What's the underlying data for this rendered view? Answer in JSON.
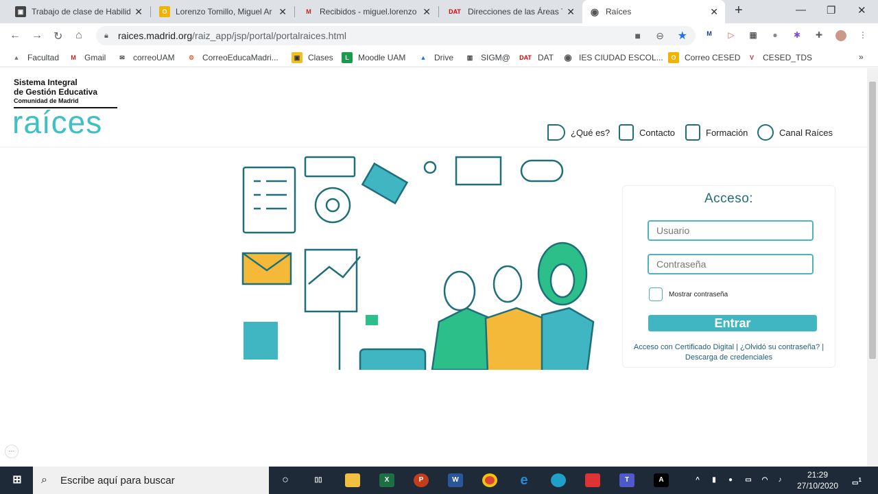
{
  "browser": {
    "tabs": [
      {
        "title": "Trabajo de clase de Habilid",
        "icon": "classroom-icon",
        "color": "#444"
      },
      {
        "title": "Lorenzo Tomillo, Miguel Ar",
        "icon": "outlook-icon",
        "color": "#f0b400"
      },
      {
        "title": "Recibidos - miguel.lorenzo",
        "icon": "gmail-icon",
        "color": "#c5221f"
      },
      {
        "title": "Direcciones de las Áreas Te",
        "icon": "dat-icon",
        "color": "#d00"
      },
      {
        "title": "Raíces",
        "icon": "globe-icon",
        "color": "#555"
      }
    ],
    "new_tab": "+",
    "url_host": "raices.madrid.org",
    "url_path": "/raiz_app/jsp/portal/portalraices.html",
    "bookmarks": [
      {
        "label": "Facultad",
        "color": "#777"
      },
      {
        "label": "Gmail",
        "color": "#c5221f"
      },
      {
        "label": "correoUAM",
        "color": "#444"
      },
      {
        "label": "CorreoEducaMadri...",
        "color": "#e06030"
      },
      {
        "label": "Clases",
        "color": "#f0c020"
      },
      {
        "label": "Moodle UAM",
        "color": "#1a9a4a"
      },
      {
        "label": "Drive",
        "color": "#1a73e8"
      },
      {
        "label": "SIGM@",
        "color": "#333"
      },
      {
        "label": "DAT",
        "color": "#d00"
      },
      {
        "label": "IES CIUDAD ESCOL...",
        "color": "#555"
      },
      {
        "label": "Correo CESED",
        "color": "#f0b400"
      },
      {
        "label": "CESED_TDS",
        "color": "#c03050"
      }
    ],
    "more": "»"
  },
  "site": {
    "logo": {
      "line1": "Sistema Integral",
      "line2": "de Gestión Educativa",
      "line3": "Comunidad de Madrid",
      "brand": "raíces"
    },
    "nav": [
      {
        "label": "¿Qué es?"
      },
      {
        "label": "Contacto"
      },
      {
        "label": "Formación"
      },
      {
        "label": "Canal Raíces"
      }
    ],
    "login": {
      "title": "Acceso:",
      "user_placeholder": "Usuario",
      "pass_placeholder": "Contraseña",
      "show_password": "Mostrar contraseña",
      "submit": "Entrar",
      "link_cert": "Acceso con Certificado Digital",
      "link_forgot": "¿Olvidó su contraseña?",
      "link_download": "Descarga de credenciales",
      "sep": "|"
    },
    "colors": {
      "accent": "#3fb6c1",
      "dark": "#1e6f7a",
      "green": "#2dbf8a",
      "yellow": "#f5b93a"
    }
  },
  "taskbar": {
    "search_placeholder": "Escribe aquí para buscar",
    "time": "21:29",
    "date": "27/10/2020",
    "notifications": "1"
  }
}
